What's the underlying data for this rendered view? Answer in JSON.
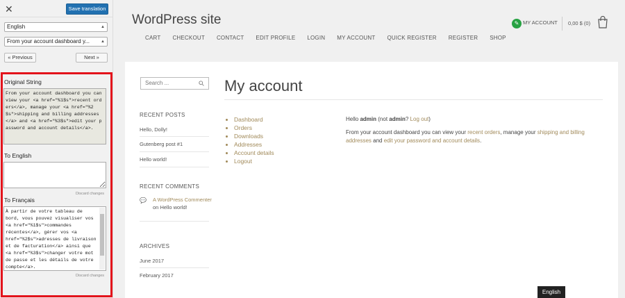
{
  "panel": {
    "close_icon": "✕",
    "save_label": "Save translation",
    "language_select": "English",
    "string_select": "From your account dashboard y...",
    "prev_label": "« Previous",
    "next_label": "Next »",
    "original_label": "Original String",
    "original_text": "From your account dashboard you can view your <a href=\"%1$s\">recent orders</a>, manage your <a href=\"%2$s\">shipping and billing addresses</a> and <a href=\"%3$s\">edit your password and account details</a>.",
    "english_label": "To English",
    "english_value": "",
    "english_discard": "Discard changes",
    "french_label": "To Français",
    "french_value": "À partir de votre tableau de bord, vous pouvez visualiser vos <a href=\"%1$s\">commandes récentes</a>, gérer vos <a href=\"%2$s\">adresses de livraison et de facturation</a> ainsi que <a href=\"%3$s\">changer votre mot de passe et les détails de votre compte</a>.",
    "french_discard": "Discard changes"
  },
  "site": {
    "title": "WordPress site",
    "menu": [
      "CART",
      "CHECKOUT",
      "CONTACT",
      "EDIT PROFILE",
      "LOGIN",
      "MY ACCOUNT",
      "QUICK REGISTER",
      "REGISTER",
      "SHOP"
    ],
    "account_label": "MY ACCOUNT",
    "cart_amount": "0,00 $ (0)",
    "search_placeholder": "Search ...",
    "recent_posts_title": "RECENT POSTS",
    "recent_posts": [
      "Hello, Dolly!",
      "Gutenberg post #1",
      "Hello world!"
    ],
    "recent_comments_title": "RECENT COMMENTS",
    "comment_author": "A WordPress Commenter",
    "comment_on": "on",
    "comment_post": "Hello world!",
    "archives_title": "ARCHIVES",
    "archives": [
      "June 2017",
      "February 2017"
    ],
    "page_title": "My account",
    "account_nav": [
      "Dashboard",
      "Orders",
      "Downloads",
      "Addresses",
      "Account details",
      "Logout"
    ],
    "hello_prefix": "Hello",
    "hello_user": "admin",
    "hello_not": "(not",
    "hello_user2": "admin",
    "hello_q": "?",
    "logout_link": "Log out",
    "hello_close": ")",
    "desc_1": "From your account dashboard you can view your",
    "desc_link1": "recent orders",
    "desc_2": ", manage your",
    "desc_link2": "shipping and billing addresses",
    "desc_3": "and",
    "desc_link3": "edit your password and account details",
    "desc_4": ".",
    "language_badge": "English"
  },
  "colors": {
    "accent": "#2271b1",
    "highlight": "#e3131b",
    "link": "#a18a5a",
    "account_icon": "#27a243"
  }
}
